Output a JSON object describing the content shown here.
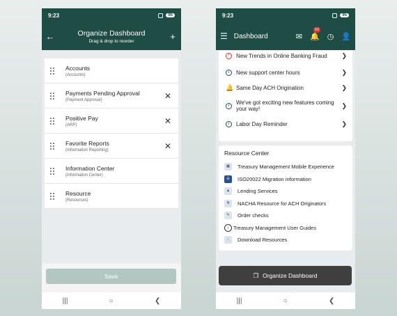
{
  "left": {
    "status_time": "9:23",
    "battery": "95",
    "header_title": "Organize Dashboard",
    "header_subtitle": "Drag & drop to reorder",
    "items": [
      {
        "name": "Accounts",
        "sub": "(Accounts)",
        "removable": false
      },
      {
        "name": "Payments Pending Approval",
        "sub": "(Payment Approval)",
        "removable": true
      },
      {
        "name": "Positive Pay",
        "sub": "(ARP)",
        "removable": true
      },
      {
        "name": "Favorite Reports",
        "sub": "(Information Reporting)",
        "removable": true
      },
      {
        "name": "Information Center",
        "sub": "(Information Center)",
        "removable": false
      },
      {
        "name": "Resource",
        "sub": "(Resources)",
        "removable": false
      }
    ],
    "save_label": "Save"
  },
  "right": {
    "status_time": "9:23",
    "battery": "95",
    "header_title": "Dashboard",
    "notification_count": "53",
    "notifications": [
      {
        "text": "New Trends in Online Banking Fraud",
        "icon": "alert-circle-icon"
      },
      {
        "text": "New support center hours",
        "icon": "info-icon"
      },
      {
        "text": "Same Day ACH Origination",
        "icon": "bell-icon"
      },
      {
        "text": "We've got exciting new features coming your way!",
        "icon": "info-icon"
      },
      {
        "text": "Labor Day Reminder",
        "icon": "info-icon"
      }
    ],
    "resource_center_title": "Resource Center",
    "resources": [
      {
        "text": "Treasury Management Mobile Experience",
        "icon": "qr-code-icon"
      },
      {
        "text": "ISO20022 Migration information",
        "icon": "document-icon"
      },
      {
        "text": "Lending Services",
        "icon": "bank-icon"
      },
      {
        "text": "NACHA Resource for ACH Originators",
        "icon": "nacha-icon"
      },
      {
        "text": "Order checks",
        "icon": "check-icon"
      },
      {
        "text": "Treasury Management User Guides",
        "icon": "info-icon"
      },
      {
        "text": "Download Resources",
        "icon": "download-icon"
      }
    ],
    "organize_label": "Organize Dashboard"
  },
  "colors": {
    "brand": "#1e4d45",
    "alert": "#d9342b",
    "save_disabled": "#b3c7c2",
    "organize_btn": "#3f3f3f"
  }
}
